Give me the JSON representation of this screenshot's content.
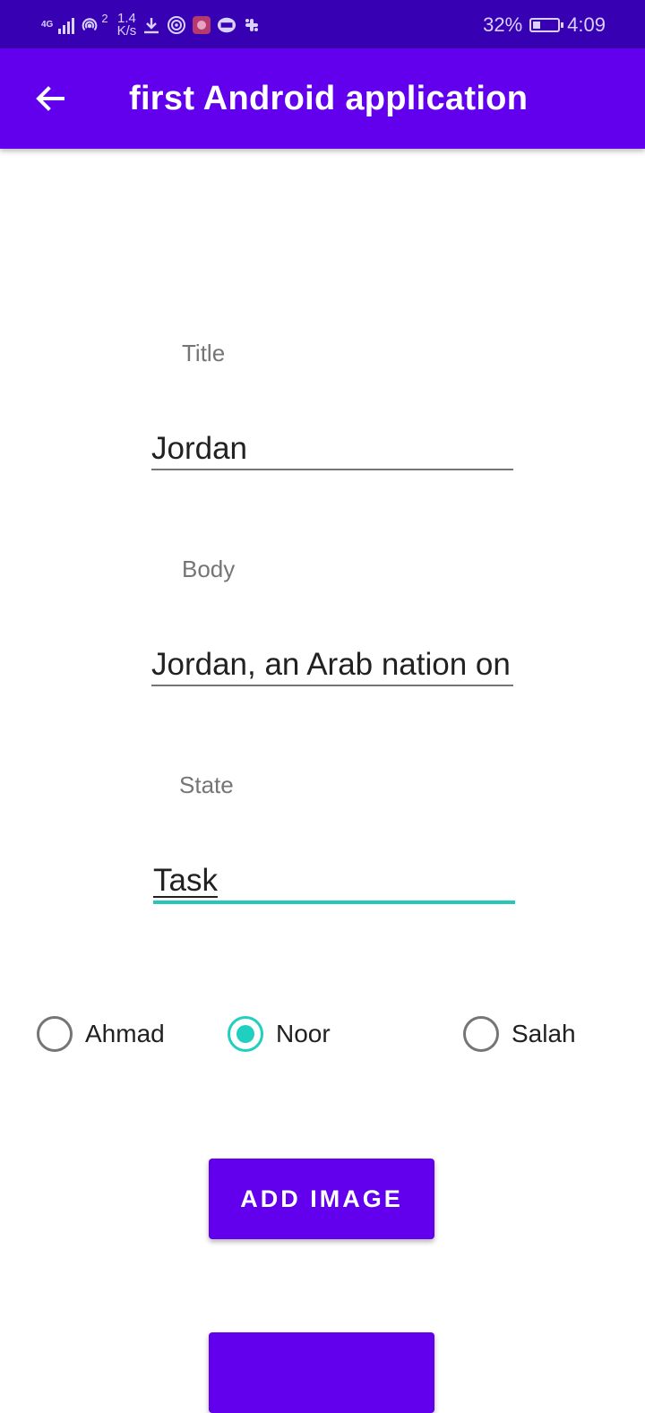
{
  "status_bar": {
    "network": "4G",
    "sim_sup": "2",
    "speed_value": "1.4",
    "speed_unit": "K/s",
    "battery": "32%",
    "battery_level": 0.32,
    "time": "4:09",
    "icons": [
      "signal-icon",
      "hotspot-icon",
      "download-icon",
      "wifi-icon",
      "app-notification-icon",
      "office-icon",
      "slack-icon"
    ]
  },
  "app_bar": {
    "title": "first Android application",
    "back_icon": "arrow-back-icon"
  },
  "form": {
    "title_label": "Title",
    "title_value": "Jordan",
    "body_label": "Body",
    "body_value": "Jordan, an Arab nation on the east bank of the Jordan River",
    "state_label": "State",
    "state_value": "Task"
  },
  "radios": [
    {
      "label": "Ahmad",
      "checked": false
    },
    {
      "label": "Noor",
      "checked": true
    },
    {
      "label": "Salah",
      "checked": false
    }
  ],
  "buttons": {
    "add_image": "ADD IMAGE",
    "second": ""
  },
  "colors": {
    "status_bar": "#3700b3",
    "primary": "#6200ee",
    "accent": "#1fd0c0"
  }
}
